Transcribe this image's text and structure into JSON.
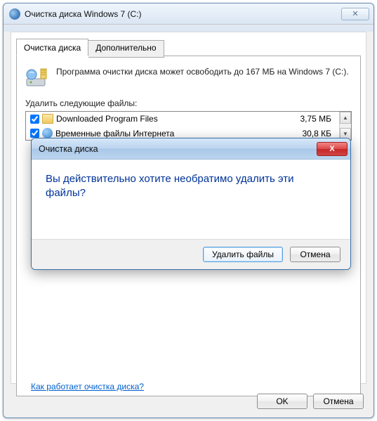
{
  "window": {
    "title": "Очистка диска Windows 7 (C:)",
    "close_glyph": "✕"
  },
  "tabs": {
    "main": "Очистка диска",
    "additional": "Дополнительно"
  },
  "info": {
    "message": "Программа очистки диска может освободить до 167 МБ на Windows 7 (C:)."
  },
  "list": {
    "label": "Удалить следующие файлы:",
    "items": [
      {
        "name": "Downloaded Program Files",
        "size": "3,75 МБ",
        "checked": true,
        "icon": "folder"
      },
      {
        "name": "Временные файлы Интернета",
        "size": "30,8 КБ",
        "checked": true,
        "icon": "globe"
      }
    ],
    "scroll_up": "▲",
    "scroll_down": "▼"
  },
  "help_link": "Как работает очистка диска?",
  "footer": {
    "ok": "OK",
    "cancel": "Отмена"
  },
  "modal": {
    "title": "Очистка диска",
    "close_glyph": "X",
    "message": "Вы действительно хотите необратимо удалить эти файлы?",
    "confirm": "Удалить файлы",
    "cancel": "Отмена"
  }
}
